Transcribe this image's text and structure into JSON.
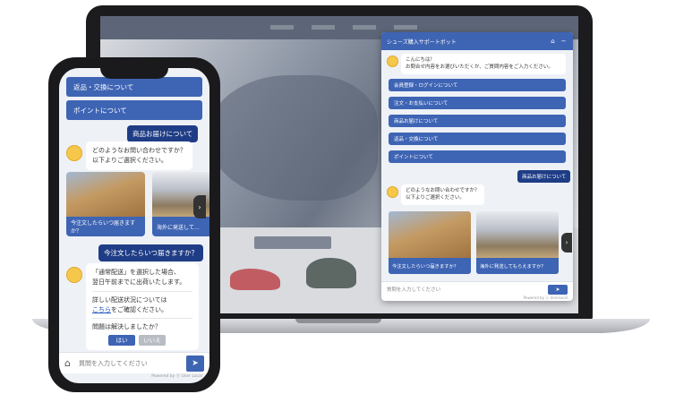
{
  "desktop_chat": {
    "title": "シューズ購入サポートボット",
    "home_icon": "home-icon",
    "minimize_icon": "minimize-icon",
    "greeting": [
      "こんにちは！",
      "お問合せ内容をお選びいただくか、ご質問内容をご入力ください。"
    ],
    "options": [
      "会員登録・ログインについて",
      "注文・お支払いについて",
      "商品お届けについて",
      "返品・交換について",
      "ポイントについて"
    ],
    "user_reply": "商品お届けについて",
    "bot_question": [
      "どのようなお問い合わせですか？",
      "以下よりご選択ください。"
    ],
    "cards": [
      "今注文したらいつ届きますか？",
      "海外に発送してもらえますか？"
    ],
    "input_placeholder": "質問を入力してください",
    "send_label": "➤",
    "powered_by": "Powered by ⓤ UserLocal"
  },
  "phone_chat": {
    "options": [
      "返品・交換について",
      "ポイントについて"
    ],
    "user_reply_1": "商品お届けについて",
    "bot_question": [
      "どのようなお問い合わせですか？",
      "以下よりご選択ください。"
    ],
    "cards": [
      "今注文したらいつ届きますか？",
      "海外に発送して…"
    ],
    "user_reply_2": "今注文したらいつ届きますか？",
    "answer_line1": "「通常配送」を選択した場合、",
    "answer_line2": "翌日午前までに出荷いたします。",
    "answer_line3": "詳しい配送状況については",
    "answer_link": "こちら",
    "answer_line4_suffix": "をご確認ください。",
    "resolved_question": "問題は解決しましたか？",
    "yes_label": "はい",
    "no_label": "いいえ",
    "input_placeholder": "質問を入力してください",
    "send_label": "➤",
    "home_icon_glyph": "⌂",
    "powered_by": "Powered by ⓤ User Local"
  },
  "colors": {
    "brand_blue": "#3e64b4",
    "user_bubble": "#1f3d86",
    "chat_bg": "#eef1f6"
  }
}
